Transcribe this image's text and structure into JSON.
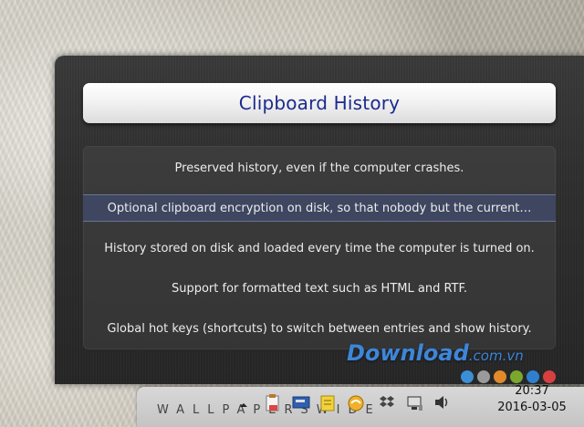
{
  "window": {
    "title": "Clipboard History",
    "items": [
      {
        "text": "Preserved history, even if the computer crashes.",
        "selected": false
      },
      {
        "text": "Optional clipboard encryption on disk, so that nobody but the current…",
        "selected": true
      },
      {
        "text": "History stored on disk and loaded every time the computer is turned on.",
        "selected": false
      },
      {
        "text": "Support for formatted text such as HTML and RTF.",
        "selected": false
      },
      {
        "text": "Global hot keys (shortcuts) to switch between entries and show history.",
        "selected": false
      }
    ]
  },
  "watermark": {
    "main": "Download",
    "suffix": ".com.vn"
  },
  "taskbar": {
    "brand": "WALLPAPERSWIDE",
    "tray_icons": [
      "chevron-up-icon",
      "clipboard-icon",
      "network-card-icon",
      "note-icon",
      "sync-icon",
      "dropbox-icon",
      "network-icon",
      "volume-icon"
    ],
    "time": "20:37",
    "date": "2016-03-05"
  },
  "accent_dots": [
    "#3a8fd6",
    "#9a9a9a",
    "#e08a2a",
    "#7aa82c",
    "#2f7fcf",
    "#d64040"
  ]
}
